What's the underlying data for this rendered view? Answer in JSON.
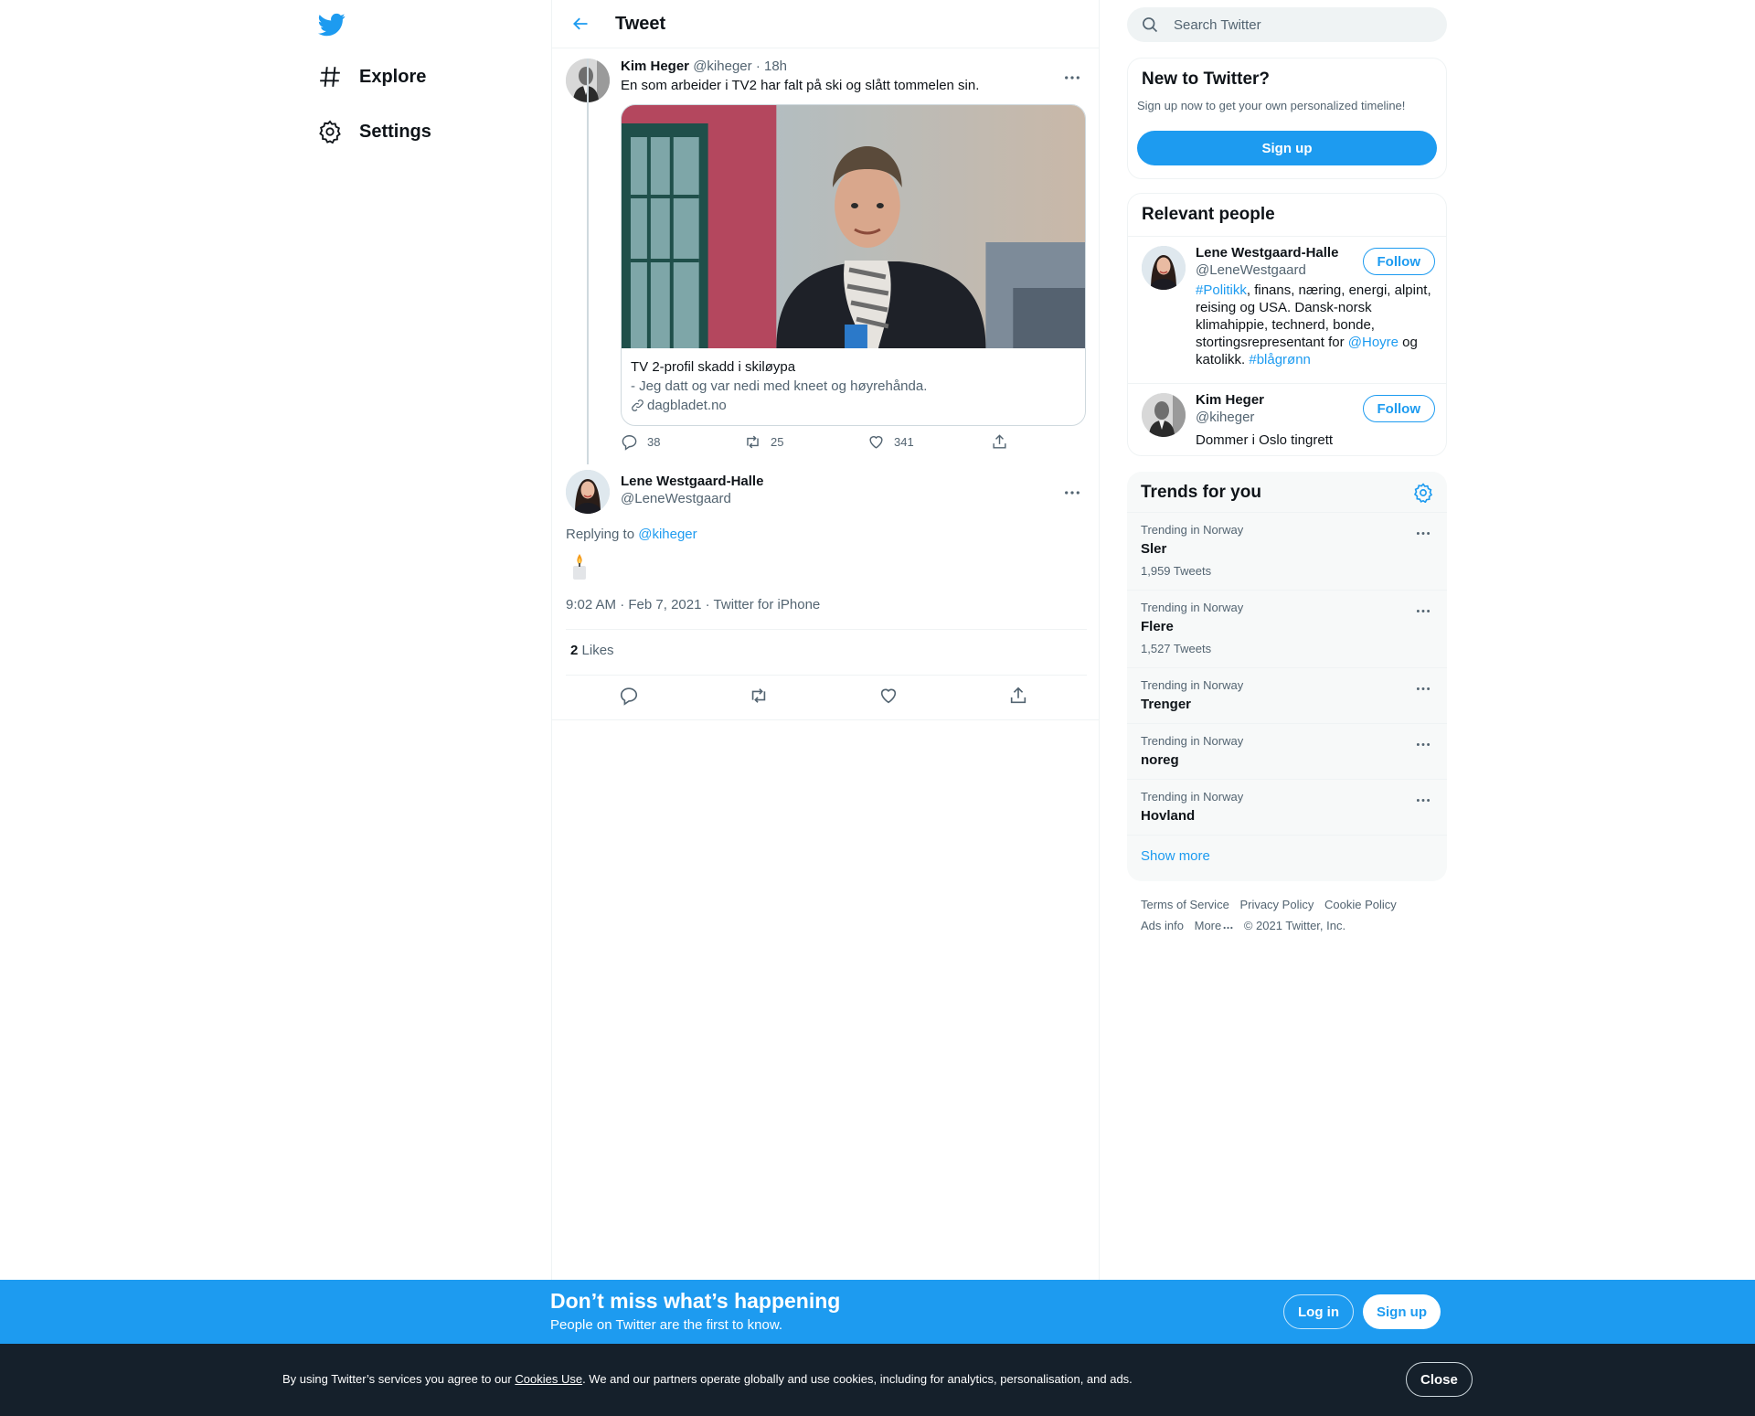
{
  "colors": {
    "accent": "#1d9bf0",
    "text": "#0f1419",
    "secondary": "#536471",
    "cookie_bg": "#15202b"
  },
  "nav": {
    "logo_icon": "twitter-bird-icon",
    "items": [
      {
        "label": "Explore",
        "icon": "hashtag-icon"
      },
      {
        "label": "Settings",
        "icon": "gear-icon"
      }
    ]
  },
  "header": {
    "title": "Tweet",
    "back_icon": "arrow-left-icon"
  },
  "tweet1": {
    "name": "Kim Heger",
    "handle": "@kiheger",
    "time": "18h",
    "text": "En som arbeider i TV2 har falt på ski og slått tommelen sin.",
    "card": {
      "title": "TV 2-profil skadd i skiløypa",
      "description": "- Jeg datt og var nedi med kneet og høyrehånda.",
      "domain": "dagbladet.no"
    },
    "actions": {
      "replies": "38",
      "retweets": "25",
      "likes": "341"
    }
  },
  "tweet2": {
    "name": "Lene Westgaard-Halle",
    "handle": "@LeneWestgaard",
    "replying_label": "Replying to",
    "replying_to": "@kiheger",
    "emoji": "candle-icon",
    "time": "9:02 AM",
    "date": "Feb 7, 2021",
    "source": "Twitter for iPhone",
    "likes_count": "2",
    "likes_label": "Likes"
  },
  "search": {
    "placeholder": "Search Twitter"
  },
  "new_to_twitter": {
    "title": "New to Twitter?",
    "subtitle": "Sign up now to get your own personalized timeline!",
    "button": "Sign up"
  },
  "relevant_people": {
    "title": "Relevant people",
    "people": [
      {
        "name": "Lene Westgaard-Halle",
        "handle": "@LeneWestgaard",
        "follow": "Follow",
        "bio": {
          "tag1": "#Politikk",
          "text1": ", finans, næring, energi, alpint, reising og USA. Dansk-norsk klimahippie, technerd, bonde, stortingsrepresentant for ",
          "mention": "@Hoyre",
          "text2": " og katolikk. ",
          "tag2": "#blågrønn"
        }
      },
      {
        "name": "Kim Heger",
        "handle": "@kiheger",
        "follow": "Follow",
        "bio_text": "Dommer i Oslo tingrett"
      }
    ]
  },
  "trends": {
    "title": "Trends for you",
    "items": [
      {
        "context": "Trending in Norway",
        "name": "Sler",
        "count": "1,959 Tweets"
      },
      {
        "context": "Trending in Norway",
        "name": "Flere",
        "count": "1,527 Tweets"
      },
      {
        "context": "Trending in Norway",
        "name": "Trenger",
        "count": ""
      },
      {
        "context": "Trending in Norway",
        "name": "noreg",
        "count": ""
      },
      {
        "context": "Trending in Norway",
        "name": "Hovland",
        "count": ""
      }
    ],
    "show_more": "Show more"
  },
  "footer": {
    "terms": "Terms of Service",
    "privacy": "Privacy Policy",
    "cookie": "Cookie Policy",
    "ads": "Ads info",
    "more": "More",
    "copyright": "© 2021 Twitter, Inc."
  },
  "promo": {
    "title": "Don’t miss what’s happening",
    "subtitle": "People on Twitter are the first to know.",
    "login": "Log in",
    "signup": "Sign up"
  },
  "cookie": {
    "text_before": "By using Twitter’s services you agree to our ",
    "link": "Cookies Use",
    "text_after": ". We and our partners operate globally and use cookies, including for analytics, personalisation, and ads.",
    "close": "Close"
  }
}
